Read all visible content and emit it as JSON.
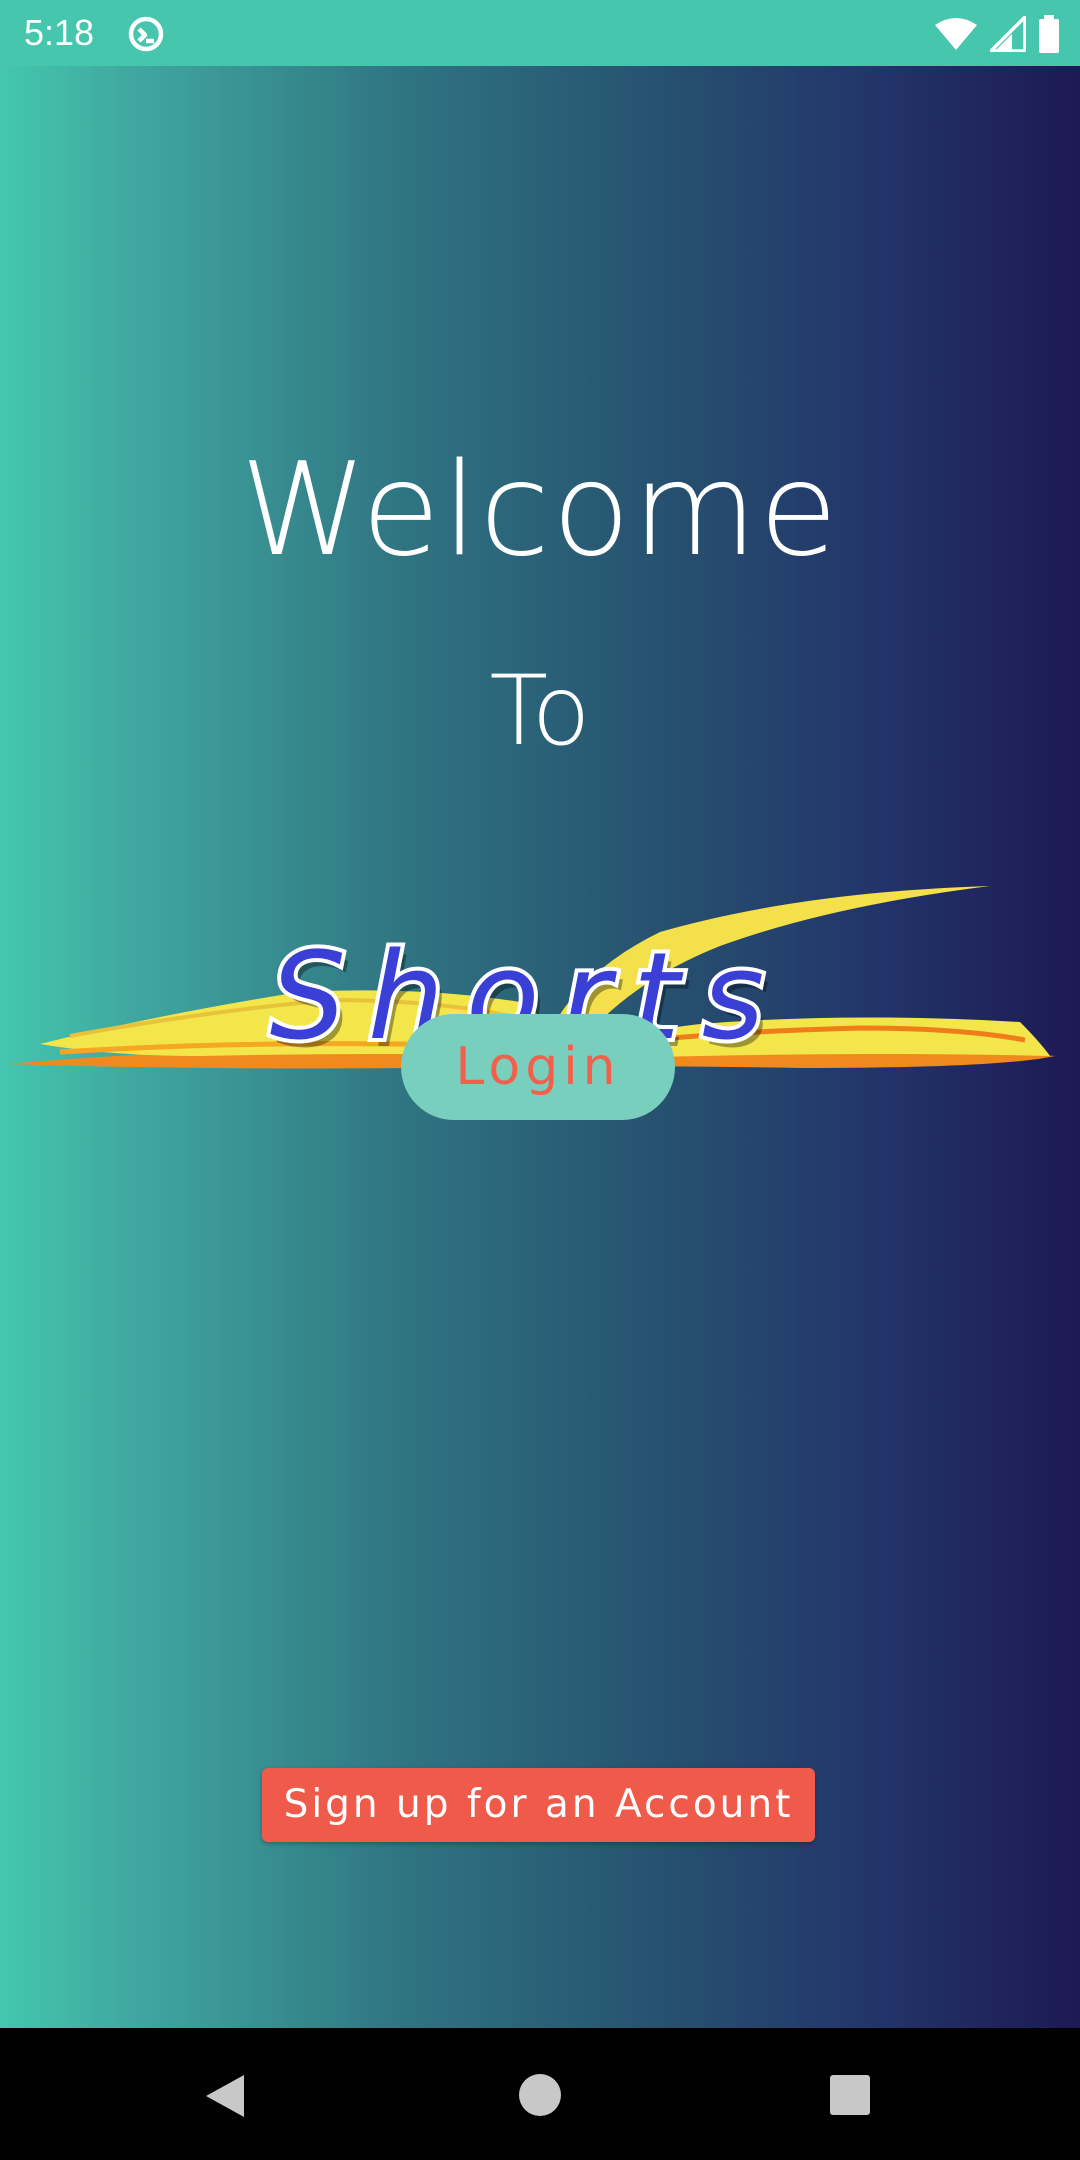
{
  "status_bar": {
    "time": "5:18",
    "icons": [
      "sync-icon",
      "wifi-icon",
      "signal-icon",
      "battery-icon"
    ]
  },
  "welcome": {
    "line1": "Welcome",
    "line2": "To",
    "logo_text": "Shorts"
  },
  "buttons": {
    "login": "Login",
    "signup": "Sign up for an Account"
  },
  "nav_bar": {
    "icons": [
      "back-icon",
      "home-icon",
      "recents-icon"
    ]
  },
  "colors": {
    "status_bar": "#45c6ad",
    "gradient_start": "#44c7ae",
    "gradient_end": "#1d1954",
    "login_bg": "#79cfbe",
    "login_text": "#f2604c",
    "signup_bg": "#ef5a4a",
    "logo_text": "#3a3fd6",
    "book_yellow": "#f3e64a",
    "book_orange": "#f08a1c"
  }
}
